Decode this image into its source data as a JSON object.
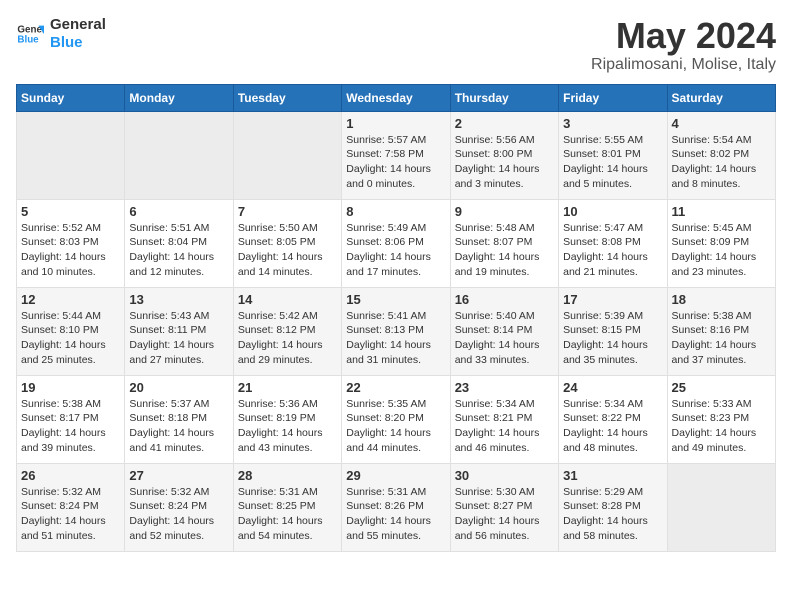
{
  "header": {
    "logo_line1": "General",
    "logo_line2": "Blue",
    "month": "May 2024",
    "location": "Ripalimosani, Molise, Italy"
  },
  "weekdays": [
    "Sunday",
    "Monday",
    "Tuesday",
    "Wednesday",
    "Thursday",
    "Friday",
    "Saturday"
  ],
  "weeks": [
    [
      {
        "day": "",
        "empty": true
      },
      {
        "day": "",
        "empty": true
      },
      {
        "day": "",
        "empty": true
      },
      {
        "day": "1",
        "sunrise": "5:57 AM",
        "sunset": "7:58 PM",
        "daylight": "14 hours and 0 minutes."
      },
      {
        "day": "2",
        "sunrise": "5:56 AM",
        "sunset": "8:00 PM",
        "daylight": "14 hours and 3 minutes."
      },
      {
        "day": "3",
        "sunrise": "5:55 AM",
        "sunset": "8:01 PM",
        "daylight": "14 hours and 5 minutes."
      },
      {
        "day": "4",
        "sunrise": "5:54 AM",
        "sunset": "8:02 PM",
        "daylight": "14 hours and 8 minutes."
      }
    ],
    [
      {
        "day": "5",
        "sunrise": "5:52 AM",
        "sunset": "8:03 PM",
        "daylight": "14 hours and 10 minutes."
      },
      {
        "day": "6",
        "sunrise": "5:51 AM",
        "sunset": "8:04 PM",
        "daylight": "14 hours and 12 minutes."
      },
      {
        "day": "7",
        "sunrise": "5:50 AM",
        "sunset": "8:05 PM",
        "daylight": "14 hours and 14 minutes."
      },
      {
        "day": "8",
        "sunrise": "5:49 AM",
        "sunset": "8:06 PM",
        "daylight": "14 hours and 17 minutes."
      },
      {
        "day": "9",
        "sunrise": "5:48 AM",
        "sunset": "8:07 PM",
        "daylight": "14 hours and 19 minutes."
      },
      {
        "day": "10",
        "sunrise": "5:47 AM",
        "sunset": "8:08 PM",
        "daylight": "14 hours and 21 minutes."
      },
      {
        "day": "11",
        "sunrise": "5:45 AM",
        "sunset": "8:09 PM",
        "daylight": "14 hours and 23 minutes."
      }
    ],
    [
      {
        "day": "12",
        "sunrise": "5:44 AM",
        "sunset": "8:10 PM",
        "daylight": "14 hours and 25 minutes."
      },
      {
        "day": "13",
        "sunrise": "5:43 AM",
        "sunset": "8:11 PM",
        "daylight": "14 hours and 27 minutes."
      },
      {
        "day": "14",
        "sunrise": "5:42 AM",
        "sunset": "8:12 PM",
        "daylight": "14 hours and 29 minutes."
      },
      {
        "day": "15",
        "sunrise": "5:41 AM",
        "sunset": "8:13 PM",
        "daylight": "14 hours and 31 minutes."
      },
      {
        "day": "16",
        "sunrise": "5:40 AM",
        "sunset": "8:14 PM",
        "daylight": "14 hours and 33 minutes."
      },
      {
        "day": "17",
        "sunrise": "5:39 AM",
        "sunset": "8:15 PM",
        "daylight": "14 hours and 35 minutes."
      },
      {
        "day": "18",
        "sunrise": "5:38 AM",
        "sunset": "8:16 PM",
        "daylight": "14 hours and 37 minutes."
      }
    ],
    [
      {
        "day": "19",
        "sunrise": "5:38 AM",
        "sunset": "8:17 PM",
        "daylight": "14 hours and 39 minutes."
      },
      {
        "day": "20",
        "sunrise": "5:37 AM",
        "sunset": "8:18 PM",
        "daylight": "14 hours and 41 minutes."
      },
      {
        "day": "21",
        "sunrise": "5:36 AM",
        "sunset": "8:19 PM",
        "daylight": "14 hours and 43 minutes."
      },
      {
        "day": "22",
        "sunrise": "5:35 AM",
        "sunset": "8:20 PM",
        "daylight": "14 hours and 44 minutes."
      },
      {
        "day": "23",
        "sunrise": "5:34 AM",
        "sunset": "8:21 PM",
        "daylight": "14 hours and 46 minutes."
      },
      {
        "day": "24",
        "sunrise": "5:34 AM",
        "sunset": "8:22 PM",
        "daylight": "14 hours and 48 minutes."
      },
      {
        "day": "25",
        "sunrise": "5:33 AM",
        "sunset": "8:23 PM",
        "daylight": "14 hours and 49 minutes."
      }
    ],
    [
      {
        "day": "26",
        "sunrise": "5:32 AM",
        "sunset": "8:24 PM",
        "daylight": "14 hours and 51 minutes."
      },
      {
        "day": "27",
        "sunrise": "5:32 AM",
        "sunset": "8:24 PM",
        "daylight": "14 hours and 52 minutes."
      },
      {
        "day": "28",
        "sunrise": "5:31 AM",
        "sunset": "8:25 PM",
        "daylight": "14 hours and 54 minutes."
      },
      {
        "day": "29",
        "sunrise": "5:31 AM",
        "sunset": "8:26 PM",
        "daylight": "14 hours and 55 minutes."
      },
      {
        "day": "30",
        "sunrise": "5:30 AM",
        "sunset": "8:27 PM",
        "daylight": "14 hours and 56 minutes."
      },
      {
        "day": "31",
        "sunrise": "5:29 AM",
        "sunset": "8:28 PM",
        "daylight": "14 hours and 58 minutes."
      },
      {
        "day": "",
        "empty": true
      }
    ]
  ],
  "labels": {
    "sunrise": "Sunrise:",
    "sunset": "Sunset:",
    "daylight": "Daylight:"
  }
}
